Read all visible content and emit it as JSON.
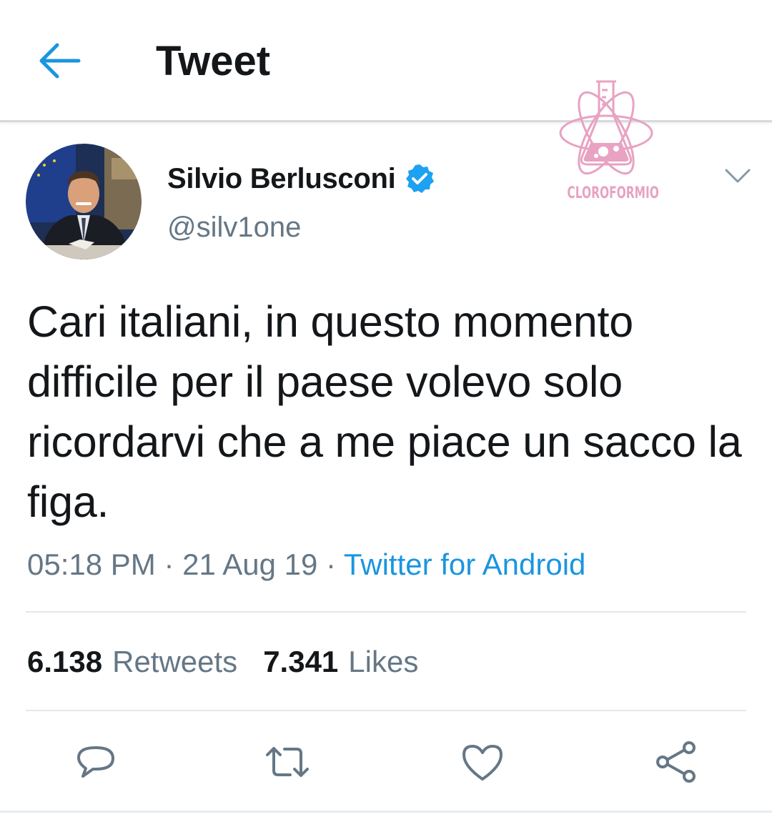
{
  "header": {
    "title": "Tweet"
  },
  "author": {
    "name": "Silvio Berlusconi",
    "handle": "@silv1one",
    "verified": true
  },
  "watermark": {
    "text": "CLOROFORMIO",
    "color": "#e8a2c2"
  },
  "tweet": {
    "text": "Cari italiani, in questo momento difficile per il paese volevo solo ricordarvi che a me piace un sacco la figa.",
    "time": "05:18 PM",
    "date": "21 Aug 19",
    "separator": "·",
    "source": "Twitter for Android"
  },
  "stats": {
    "retweets_count": "6.138",
    "retweets_label": "Retweets",
    "likes_count": "7.341",
    "likes_label": "Likes"
  },
  "actions": {
    "icons": [
      "reply-icon",
      "retweet-icon",
      "like-icon",
      "share-icon"
    ]
  },
  "colors": {
    "accent": "#1b95e0",
    "text": "#14171a",
    "secondary": "#657786",
    "divider": "#e1e8ed"
  }
}
